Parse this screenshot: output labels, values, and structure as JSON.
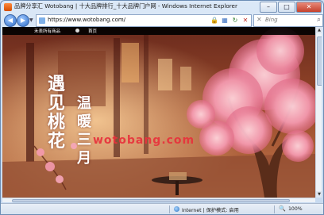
{
  "window": {
    "title": "品牌分享汇 Wotobang | 十大品牌排行_十大品牌门户网 - Windows Internet Explorer",
    "buttons": {
      "minimize": "–",
      "maximize": "□",
      "close": "✕"
    }
  },
  "address_bar": {
    "url": "https://www.wotobang.com/",
    "search_placeholder": "Bing"
  },
  "site_nav": {
    "items": [
      "禾表所有商品",
      "首页"
    ]
  },
  "banner": {
    "poem_left": [
      "遇",
      "见",
      "桃",
      "花"
    ],
    "poem_right": [
      "温",
      "暖",
      "三",
      "月"
    ],
    "watermark": "wotobang.com"
  },
  "status_bar": {
    "zone": "Internet | 保护模式: 启用",
    "zoom": "100%"
  },
  "icons": {
    "back": "back-arrow-icon",
    "forward": "forward-arrow-icon",
    "lock": "lock-icon",
    "refresh": "refresh-icon",
    "stop": "stop-icon",
    "search": "search-icon"
  }
}
